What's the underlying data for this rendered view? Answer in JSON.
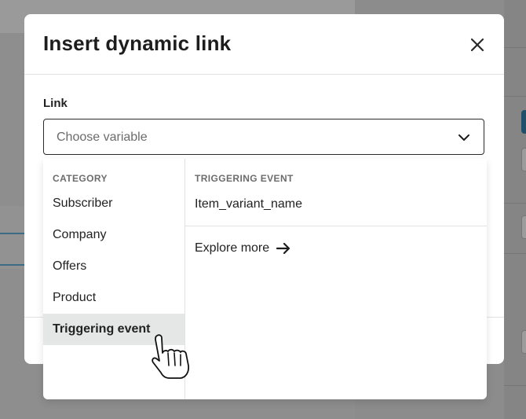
{
  "modal": {
    "title": "Insert dynamic link",
    "close_icon": "close-icon"
  },
  "link_field": {
    "label": "Link",
    "placeholder": "Choose variable",
    "chevron_icon": "chevron-down-icon"
  },
  "dropdown": {
    "category_header": "CATEGORY",
    "categories": [
      {
        "label": "Subscriber",
        "active": false
      },
      {
        "label": "Company",
        "active": false
      },
      {
        "label": "Offers",
        "active": false
      },
      {
        "label": "Product",
        "active": false
      },
      {
        "label": "Triggering event",
        "active": true
      }
    ],
    "event_header": "TRIGGERING EVENT",
    "events": [
      "Item_variant_name"
    ],
    "explore_label": "Explore more",
    "explore_icon": "arrow-right-icon"
  },
  "cursor": "hand-pointer-icon",
  "colors": {
    "overlay": "#8c8c8c",
    "active_bg": "#e5e6e6",
    "text": "#222222",
    "muted": "#6c6c6c",
    "accent_line": "#3d6a84"
  }
}
